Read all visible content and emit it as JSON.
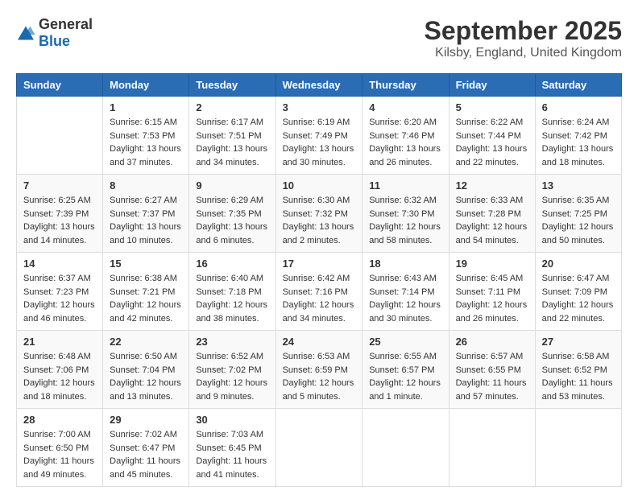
{
  "logo": {
    "general": "General",
    "blue": "Blue"
  },
  "title": "September 2025",
  "location": "Kilsby, England, United Kingdom",
  "weekdays": [
    "Sunday",
    "Monday",
    "Tuesday",
    "Wednesday",
    "Thursday",
    "Friday",
    "Saturday"
  ],
  "weeks": [
    [
      null,
      {
        "day": 1,
        "sunrise": "6:15 AM",
        "sunset": "7:53 PM",
        "daylight": "13 hours and 37 minutes."
      },
      {
        "day": 2,
        "sunrise": "6:17 AM",
        "sunset": "7:51 PM",
        "daylight": "13 hours and 34 minutes."
      },
      {
        "day": 3,
        "sunrise": "6:19 AM",
        "sunset": "7:49 PM",
        "daylight": "13 hours and 30 minutes."
      },
      {
        "day": 4,
        "sunrise": "6:20 AM",
        "sunset": "7:46 PM",
        "daylight": "13 hours and 26 minutes."
      },
      {
        "day": 5,
        "sunrise": "6:22 AM",
        "sunset": "7:44 PM",
        "daylight": "13 hours and 22 minutes."
      },
      {
        "day": 6,
        "sunrise": "6:24 AM",
        "sunset": "7:42 PM",
        "daylight": "13 hours and 18 minutes."
      }
    ],
    [
      {
        "day": 7,
        "sunrise": "6:25 AM",
        "sunset": "7:39 PM",
        "daylight": "13 hours and 14 minutes."
      },
      {
        "day": 8,
        "sunrise": "6:27 AM",
        "sunset": "7:37 PM",
        "daylight": "13 hours and 10 minutes."
      },
      {
        "day": 9,
        "sunrise": "6:29 AM",
        "sunset": "7:35 PM",
        "daylight": "13 hours and 6 minutes."
      },
      {
        "day": 10,
        "sunrise": "6:30 AM",
        "sunset": "7:32 PM",
        "daylight": "13 hours and 2 minutes."
      },
      {
        "day": 11,
        "sunrise": "6:32 AM",
        "sunset": "7:30 PM",
        "daylight": "12 hours and 58 minutes."
      },
      {
        "day": 12,
        "sunrise": "6:33 AM",
        "sunset": "7:28 PM",
        "daylight": "12 hours and 54 minutes."
      },
      {
        "day": 13,
        "sunrise": "6:35 AM",
        "sunset": "7:25 PM",
        "daylight": "12 hours and 50 minutes."
      }
    ],
    [
      {
        "day": 14,
        "sunrise": "6:37 AM",
        "sunset": "7:23 PM",
        "daylight": "12 hours and 46 minutes."
      },
      {
        "day": 15,
        "sunrise": "6:38 AM",
        "sunset": "7:21 PM",
        "daylight": "12 hours and 42 minutes."
      },
      {
        "day": 16,
        "sunrise": "6:40 AM",
        "sunset": "7:18 PM",
        "daylight": "12 hours and 38 minutes."
      },
      {
        "day": 17,
        "sunrise": "6:42 AM",
        "sunset": "7:16 PM",
        "daylight": "12 hours and 34 minutes."
      },
      {
        "day": 18,
        "sunrise": "6:43 AM",
        "sunset": "7:14 PM",
        "daylight": "12 hours and 30 minutes."
      },
      {
        "day": 19,
        "sunrise": "6:45 AM",
        "sunset": "7:11 PM",
        "daylight": "12 hours and 26 minutes."
      },
      {
        "day": 20,
        "sunrise": "6:47 AM",
        "sunset": "7:09 PM",
        "daylight": "12 hours and 22 minutes."
      }
    ],
    [
      {
        "day": 21,
        "sunrise": "6:48 AM",
        "sunset": "7:06 PM",
        "daylight": "12 hours and 18 minutes."
      },
      {
        "day": 22,
        "sunrise": "6:50 AM",
        "sunset": "7:04 PM",
        "daylight": "12 hours and 13 minutes."
      },
      {
        "day": 23,
        "sunrise": "6:52 AM",
        "sunset": "7:02 PM",
        "daylight": "12 hours and 9 minutes."
      },
      {
        "day": 24,
        "sunrise": "6:53 AM",
        "sunset": "6:59 PM",
        "daylight": "12 hours and 5 minutes."
      },
      {
        "day": 25,
        "sunrise": "6:55 AM",
        "sunset": "6:57 PM",
        "daylight": "12 hours and 1 minute."
      },
      {
        "day": 26,
        "sunrise": "6:57 AM",
        "sunset": "6:55 PM",
        "daylight": "11 hours and 57 minutes."
      },
      {
        "day": 27,
        "sunrise": "6:58 AM",
        "sunset": "6:52 PM",
        "daylight": "11 hours and 53 minutes."
      }
    ],
    [
      {
        "day": 28,
        "sunrise": "7:00 AM",
        "sunset": "6:50 PM",
        "daylight": "11 hours and 49 minutes."
      },
      {
        "day": 29,
        "sunrise": "7:02 AM",
        "sunset": "6:47 PM",
        "daylight": "11 hours and 45 minutes."
      },
      {
        "day": 30,
        "sunrise": "7:03 AM",
        "sunset": "6:45 PM",
        "daylight": "11 hours and 41 minutes."
      },
      null,
      null,
      null,
      null
    ]
  ]
}
